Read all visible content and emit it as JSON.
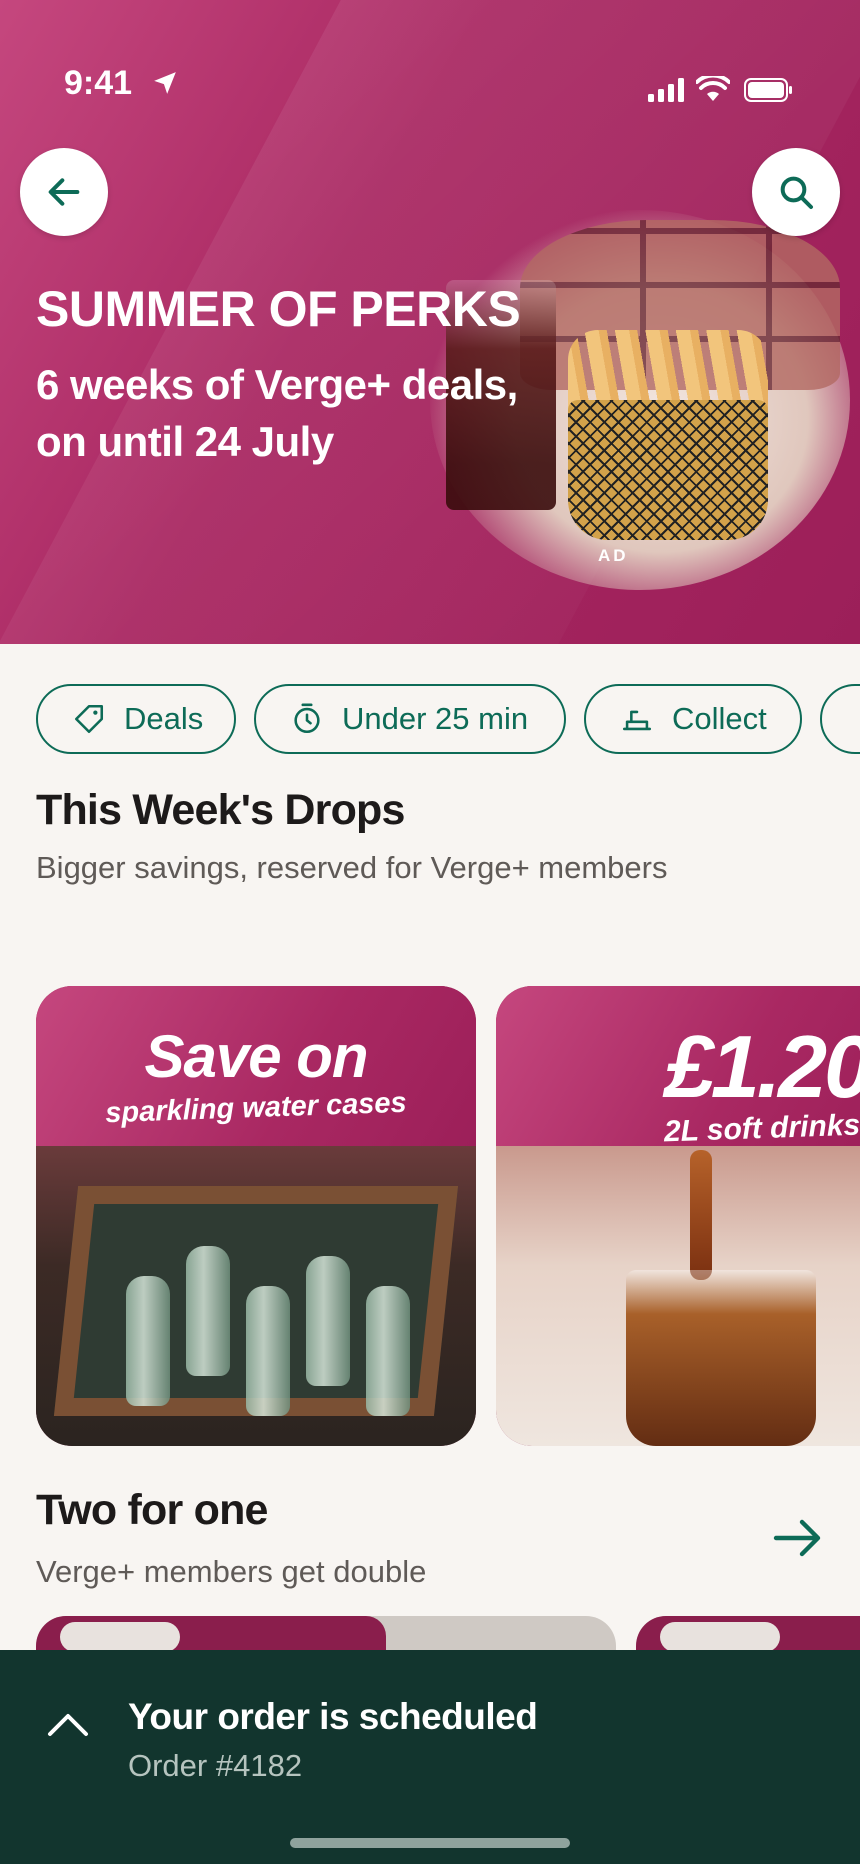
{
  "status_bar": {
    "time": "9:41"
  },
  "hero": {
    "title": "SUMMER OF PERKS",
    "subtitle": "6 weeks of Verge+ deals, on until 24 July",
    "ad_label": "AD",
    "back_icon": "arrow-left-icon",
    "search_icon": "search-icon"
  },
  "filters": [
    {
      "label": "Deals",
      "icon": "tag-icon"
    },
    {
      "label": "Under 25 min",
      "icon": "timer-icon"
    },
    {
      "label": "Collect",
      "icon": "bag-icon"
    }
  ],
  "drops": {
    "title": "This Week's Drops",
    "subtitle": "Bigger savings, reserved for Verge+ members",
    "cards": [
      {
        "headline": "Save on",
        "caption": "sparkling water cases"
      },
      {
        "headline": "£1.20",
        "caption": "2L soft drinks"
      }
    ]
  },
  "two_for_one": {
    "title": "Two for one",
    "subtitle": "Verge+ members get double"
  },
  "order": {
    "title": "Your order is scheduled",
    "number": "Order #4182"
  },
  "colors": {
    "brand": "#a92862",
    "accent": "#0d6b57",
    "bar": "#12352e"
  }
}
